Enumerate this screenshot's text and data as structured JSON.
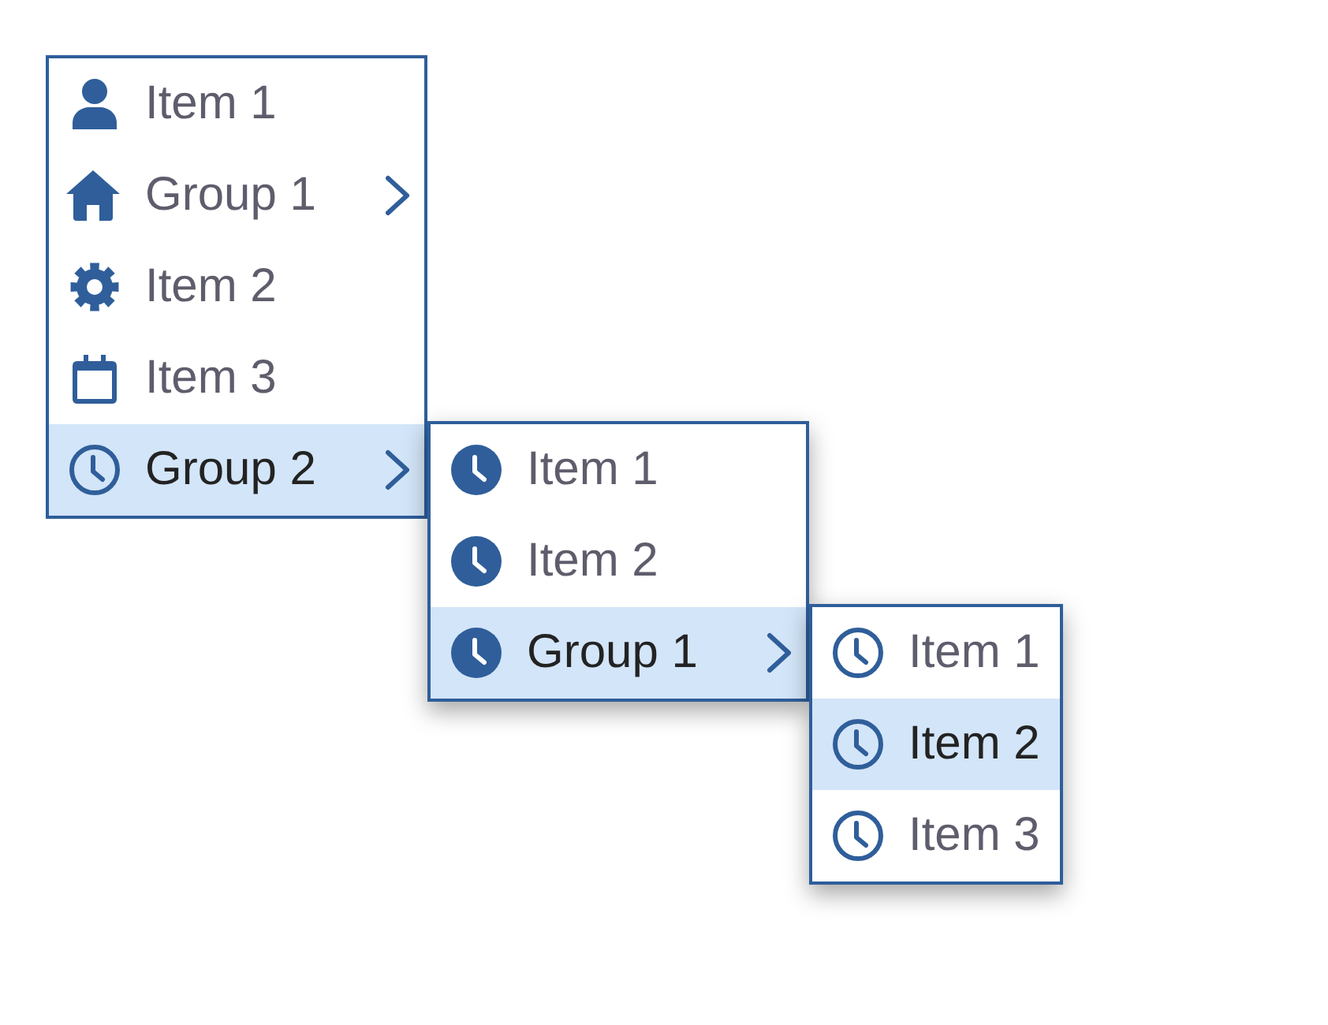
{
  "menu": {
    "items": [
      {
        "kind": "item",
        "label": "Item 1",
        "selected": false
      },
      {
        "kind": "group",
        "label": "Group 1",
        "selected": false
      },
      {
        "kind": "item",
        "label": "Item 2",
        "selected": false
      },
      {
        "kind": "item",
        "label": "Item 3",
        "selected": false
      },
      {
        "kind": "group",
        "label": "Group 2",
        "selected": true,
        "children": [
          {
            "kind": "item",
            "label": "Item 1",
            "selected": false
          },
          {
            "kind": "item",
            "label": "Item 2",
            "selected": false
          },
          {
            "kind": "group",
            "label": "Group 1",
            "selected": true,
            "children": [
              {
                "kind": "item",
                "label": "Item 1",
                "selected": false
              },
              {
                "kind": "item",
                "label": "Item 2",
                "selected": true
              },
              {
                "kind": "item",
                "label": "Item 3",
                "selected": false
              }
            ]
          }
        ]
      }
    ]
  }
}
